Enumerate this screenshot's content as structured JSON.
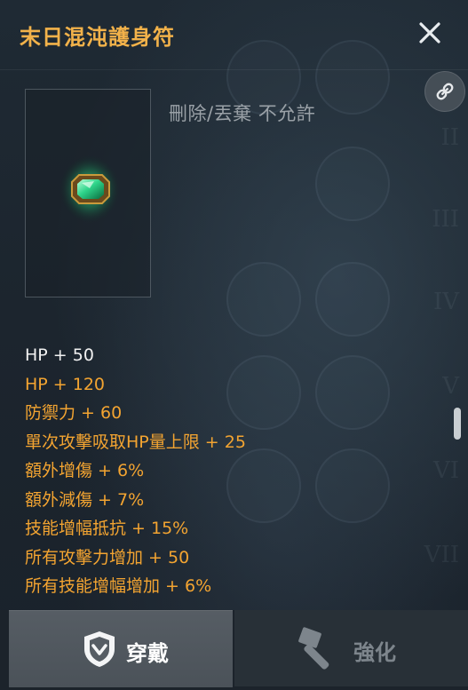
{
  "window": {
    "title": "末日混沌護身符"
  },
  "item": {
    "restriction_text": "刪除/丟棄 不允許",
    "icon": "green-gem-amulet-icon"
  },
  "stats": [
    {
      "text": "HP + 50",
      "kind": "base"
    },
    {
      "text": "HP  + 120",
      "kind": "bonus"
    },
    {
      "text": "防禦力  + 60",
      "kind": "bonus"
    },
    {
      "text": "單次攻擊吸取HP量上限  + 25",
      "kind": "bonus"
    },
    {
      "text": "額外增傷  + 6%",
      "kind": "bonus"
    },
    {
      "text": "額外減傷  + 7%",
      "kind": "bonus"
    },
    {
      "text": "技能增幅抵抗  + 15%",
      "kind": "bonus"
    },
    {
      "text": "所有攻擊力增加  + 50",
      "kind": "bonus"
    },
    {
      "text": "所有技能增幅增加  + 6%",
      "kind": "bonus"
    }
  ],
  "actions": {
    "equip_label": "穿戴",
    "enhance_label": "強化"
  },
  "icons": {
    "close": "close-icon",
    "link": "link-icon",
    "equip": "shield-icon",
    "enhance": "hammer-icon"
  },
  "colors": {
    "title": "#f2b24a",
    "bonus_stat": "#f3a431",
    "base_stat": "#f1f1f1",
    "restriction": "#9aa1a7",
    "panel_bg": "#1c252e"
  }
}
